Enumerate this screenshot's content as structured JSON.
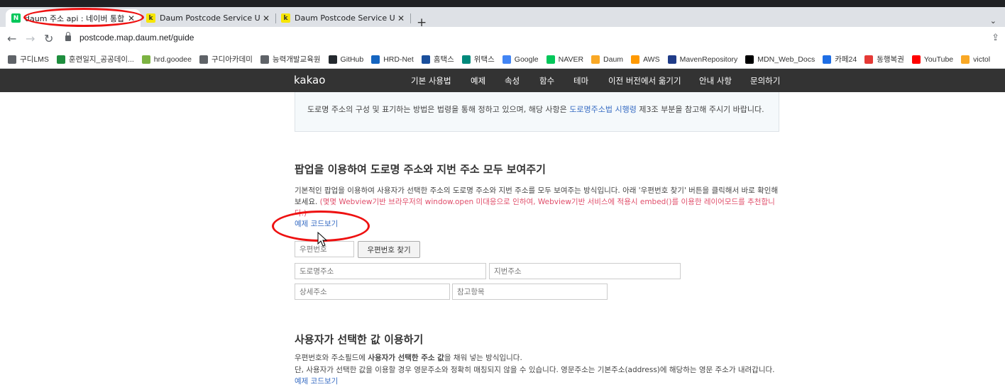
{
  "browser": {
    "tabs": [
      {
        "title": "daum 주소 api : 네이버 통합검색",
        "favicon": "N",
        "favicon_color": "#03c75a"
      },
      {
        "title": "Daum Postcode Service User Guide",
        "favicon": "k",
        "favicon_color": "#f7e600"
      },
      {
        "title": "Daum Postcode Service User Guide",
        "favicon": "k",
        "favicon_color": "#f7e600"
      }
    ],
    "new_tab": "+",
    "url": "postcode.map.daum.net/guide",
    "bookmarks": [
      {
        "label": "구디LMS",
        "icon": "globe-icon",
        "color": "#5f6368"
      },
      {
        "label": "훈련일지_공공데이...",
        "icon": "plus-icon",
        "color": "#1e8e3e"
      },
      {
        "label": "hrd.goodee",
        "icon": "leaf-icon",
        "color": "#7cb342"
      },
      {
        "label": "구디아카데미",
        "icon": "globe-icon",
        "color": "#5f6368"
      },
      {
        "label": "능력개발교육원",
        "icon": "globe-icon",
        "color": "#5f6368"
      },
      {
        "label": "GitHub",
        "icon": "github-icon",
        "color": "#24292e"
      },
      {
        "label": "HRD-Net",
        "icon": "hrd-icon",
        "color": "#1565c0"
      },
      {
        "label": "홈택스",
        "icon": "hometax-icon",
        "color": "#1a4f9c"
      },
      {
        "label": "위택스",
        "icon": "wetax-icon",
        "color": "#00897b"
      },
      {
        "label": "Google",
        "icon": "google-icon",
        "color": "#4285f4"
      },
      {
        "label": "NAVER",
        "icon": "naver-icon",
        "color": "#03c75a"
      },
      {
        "label": "Daum",
        "icon": "daum-icon",
        "color": "#f9a825"
      },
      {
        "label": "AWS",
        "icon": "aws-icon",
        "color": "#ff9900"
      },
      {
        "label": "MavenRepository",
        "icon": "maven-icon",
        "color": "#1f3c88"
      },
      {
        "label": "MDN_Web_Docs",
        "icon": "mdn-icon",
        "color": "#000000"
      },
      {
        "label": "카페24",
        "icon": "cafe24-icon",
        "color": "#1e6ee5"
      },
      {
        "label": "동행복권",
        "icon": "lotto-icon",
        "color": "#e53935"
      },
      {
        "label": "YouTube",
        "icon": "youtube-icon",
        "color": "#ff0000"
      },
      {
        "label": "victol",
        "icon": "v-icon",
        "color": "#f9a825"
      }
    ]
  },
  "kakao_nav": {
    "logo": "kakao",
    "menu": [
      "기본 사용법",
      "예제",
      "속성",
      "함수",
      "테마",
      "이전 버전에서 옮기기",
      "안내 사항",
      "문의하기"
    ]
  },
  "notice": {
    "text_before": "도로명 주소의 구성 및 표기하는 방법은 법령을 통해 정하고 있으며, 해당 사항은 ",
    "link": "도로명주소법 시행령",
    "text_after": " 제3조 부분을 참고해 주시기 바랍니다."
  },
  "section1": {
    "title": "팝업을 이용하여 도로명 주소와 지번 주소 모두 보여주기",
    "desc": "기본적인 팝업을 이용하여 사용자가 선택한 주소의 도로명 주소와 지번 주소를 모두 보여주는 방식입니다. 아래 '우편번호 찾기' 버튼을 클릭해서 바로 확인해보세요.",
    "warning": "(몇몇 Webview기반 브라우저의 window.open 미대응으로 인하여, Webview기반 서비스에 적용시 embed()를 이용한 레이어모드를 추천합니다.)",
    "code_link": "예제 코드보기"
  },
  "form": {
    "postcode_placeholder": "우편번호",
    "find_button": "우편번호 찾기",
    "road_placeholder": "도로명주소",
    "jibun_placeholder": "지번주소",
    "detail_placeholder": "상세주소",
    "extra_placeholder": "참고항목"
  },
  "section2": {
    "title": "사용자가 선택한 값 이용하기",
    "line1_a": "우편번호와 주소필드에 ",
    "line1_bold": "사용자가 선택한 주소 값",
    "line1_b": "을 채워 넣는 방식입니다.",
    "line2": "단, 사용자가 선택한 값을 이용할 경우 영문주소와 정확히 매칭되지 않을 수 있습니다. 영문주소는 기본주소(address)에 해당하는 영문 주소가 내려갑니다.",
    "code_link": "예제 코드보기"
  }
}
